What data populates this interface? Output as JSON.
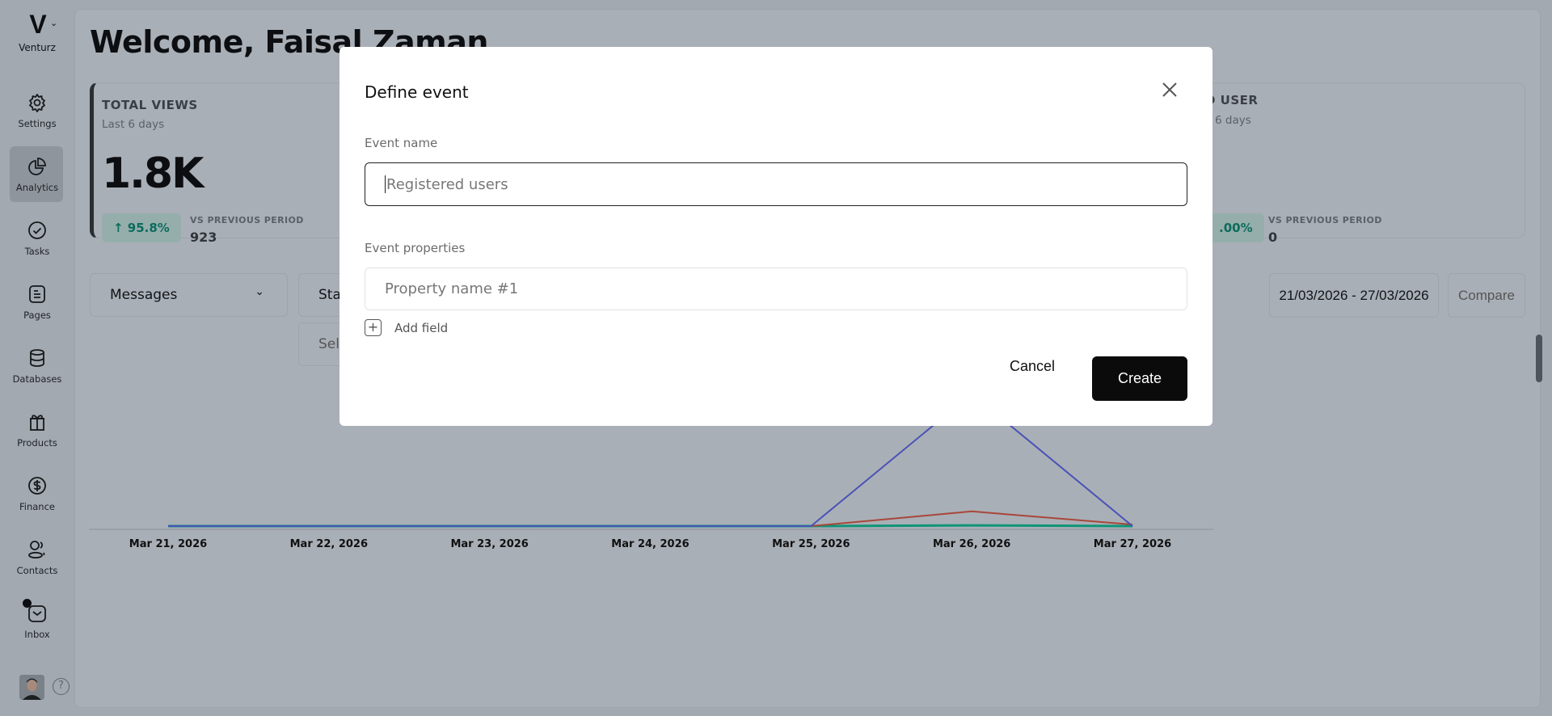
{
  "sidebar": {
    "brand": "Venturz",
    "items": [
      {
        "label": "Settings",
        "icon": "gear-icon"
      },
      {
        "label": "Analytics",
        "icon": "pie-chart-icon",
        "active": true
      },
      {
        "label": "Tasks",
        "icon": "check-circle-icon"
      },
      {
        "label": "Pages",
        "icon": "page-icon"
      },
      {
        "label": "Databases",
        "icon": "database-icon"
      },
      {
        "label": "Products",
        "icon": "gift-icon"
      },
      {
        "label": "Finance",
        "icon": "dollar-circle-icon"
      },
      {
        "label": "Contacts",
        "icon": "users-icon"
      },
      {
        "label": "Inbox",
        "icon": "inbox-icon",
        "notification": true
      }
    ],
    "help": "?"
  },
  "main": {
    "title": "Welcome, Faisal Zaman",
    "cards": [
      {
        "title": "TOTAL VIEWS",
        "subtitle": "Last 6 days",
        "value": "1.8K",
        "change": "95.8%",
        "vs_label": "VS PREVIOUS PERIOD",
        "vs_value": "923"
      },
      {
        "title": "D USER",
        "subtitle": "6 days",
        "change": ".00%",
        "vs_label": "VS PREVIOUS PERIOD",
        "vs_value": "0"
      }
    ],
    "metric_select": "Messages",
    "filter_1": "Sta",
    "filter_2": "Sel",
    "date_range": "21/03/2026 - 27/03/2026",
    "compare": "Compare"
  },
  "chart_data": {
    "type": "line",
    "x": [
      "Mar 21, 2026",
      "Mar 22, 2026",
      "Mar 23, 2026",
      "Mar 24, 2026",
      "Mar 25, 2026",
      "Mar 26, 2026",
      "Mar 27, 2026"
    ],
    "series": [
      {
        "color": "#4a52b8",
        "values": [
          0,
          0,
          0,
          0,
          0,
          9,
          0
        ]
      },
      {
        "color": "#a8473b",
        "values": [
          0,
          0,
          0,
          0,
          0,
          1,
          0.1
        ]
      },
      {
        "color": "#0e9577",
        "values": [
          0,
          0,
          0,
          0,
          0,
          0.05,
          0
        ]
      }
    ],
    "grid": false
  },
  "modal": {
    "title": "Define event",
    "event_name_label": "Event name",
    "event_name_placeholder": "Registered users",
    "event_props_label": "Event properties",
    "prop_placeholder": "Property name #1",
    "add_field": "Add field",
    "cancel": "Cancel",
    "create": "Create"
  }
}
